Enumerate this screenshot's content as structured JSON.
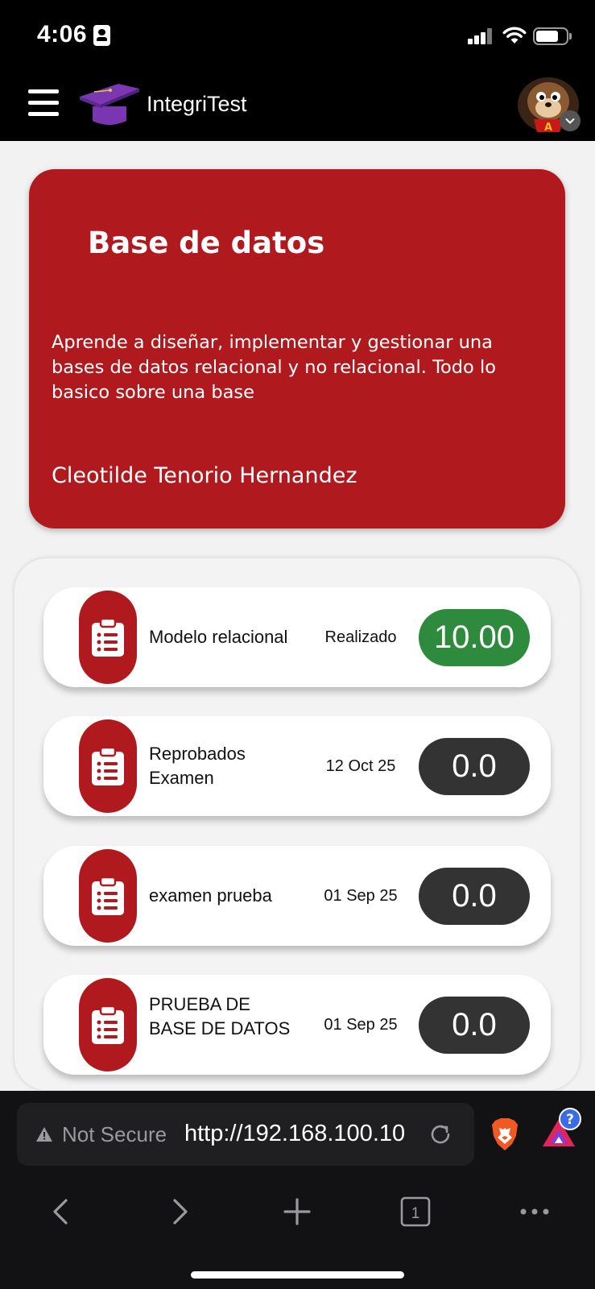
{
  "status_bar": {
    "time": "4:06",
    "battery_level": 0.75
  },
  "app": {
    "title": "IntegriTest",
    "icons": [
      "menu-icon",
      "graduation-cap-logo",
      "avatar",
      "chevron-down-icon"
    ]
  },
  "course": {
    "title": "Base de datos",
    "description": "Aprende a diseñar, implementar y gestionar una bases de datos relacional y no relacional. Todo lo basico sobre una base",
    "teacher": "Cleotilde Tenorio Hernandez",
    "card_color": "#b01a1e"
  },
  "exams": [
    {
      "name": "Modelo relacional",
      "status": "Realizado",
      "score": "10.00",
      "score_color": "#2e8b3e"
    },
    {
      "name": "Reprobados Examen",
      "status": "12 Oct 25",
      "score": "0.0",
      "score_color": "#333333"
    },
    {
      "name": "examen prueba",
      "status": "01 Sep 25",
      "score": "0.0",
      "score_color": "#333333"
    },
    {
      "name": "PRUEBA DE BASE DE DATOS",
      "status": "01 Sep 25",
      "score": "0.0",
      "score_color": "#333333"
    }
  ],
  "browser": {
    "security_label": "Not Secure",
    "url": "http://192.168.100.10",
    "tab_count": "1",
    "rewards_badge": "?",
    "icons": [
      "warning-icon",
      "reload-icon",
      "brave-shield-icon",
      "rewards-icon",
      "back-icon",
      "forward-icon",
      "new-tab-icon",
      "tabs-icon",
      "more-icon"
    ]
  }
}
